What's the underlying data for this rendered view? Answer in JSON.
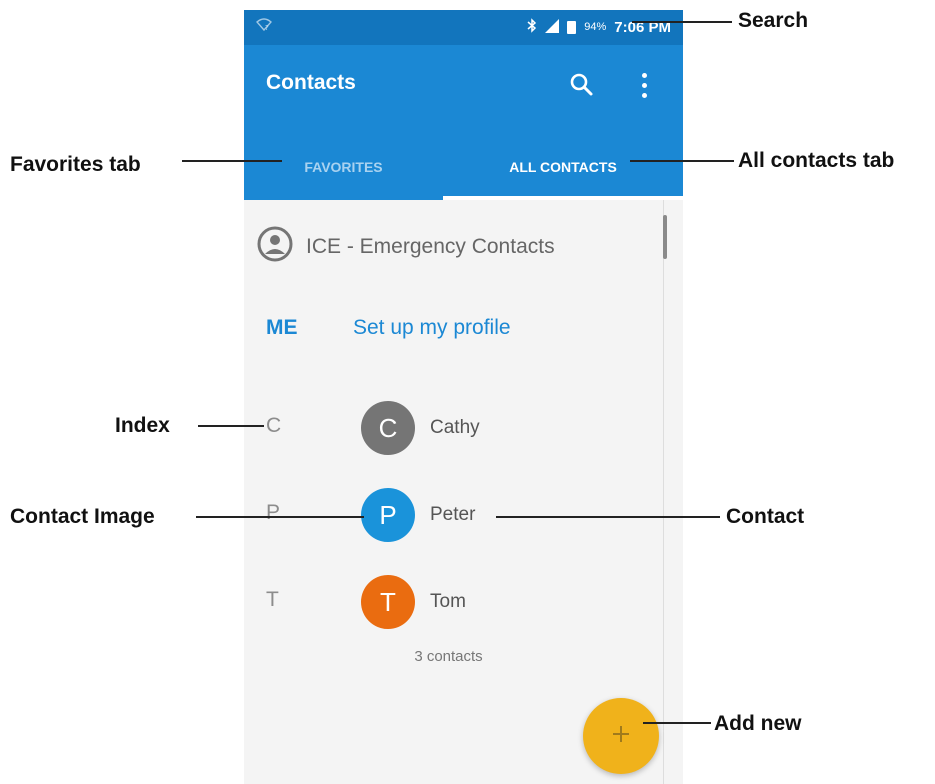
{
  "status_bar": {
    "battery": "94%",
    "time": "7:06 PM",
    "icons": [
      "wifi-icon",
      "bluetooth-icon",
      "signal-icon",
      "battery-icon"
    ]
  },
  "app_bar": {
    "title": "Contacts",
    "actions": [
      "search-icon",
      "more-vert-icon"
    ]
  },
  "tabs": [
    {
      "label": "FAVORITES",
      "selected": false
    },
    {
      "label": "ALL CONTACTS",
      "selected": true
    }
  ],
  "ice": {
    "label": "ICE - Emergency Contacts",
    "icon": "account-circle-icon"
  },
  "me": {
    "label": "ME",
    "action": "Set up my profile"
  },
  "contacts": [
    {
      "index": "C",
      "initial": "C",
      "name": "Cathy",
      "color": "#757575"
    },
    {
      "index": "P",
      "initial": "P",
      "name": "Peter",
      "color": "#1a93da"
    },
    {
      "index": "T",
      "initial": "T",
      "name": "Tom",
      "color": "#ea6c10"
    }
  ],
  "contact_count": "3 contacts",
  "fab": {
    "icon": "plus-icon",
    "color": "#f0b21b"
  },
  "annotations": {
    "search": "Search",
    "favorites_tab": "Favorites tab",
    "all_contacts_tab": "All contacts tab",
    "index": "Index",
    "contact_image": "Contact Image",
    "contact": "Contact",
    "add_new": "Add new"
  },
  "colors": {
    "status_bar": "#1275bd",
    "app_bar": "#1b88d4",
    "accent": "#1b88d4",
    "background": "#f4f4f4"
  }
}
